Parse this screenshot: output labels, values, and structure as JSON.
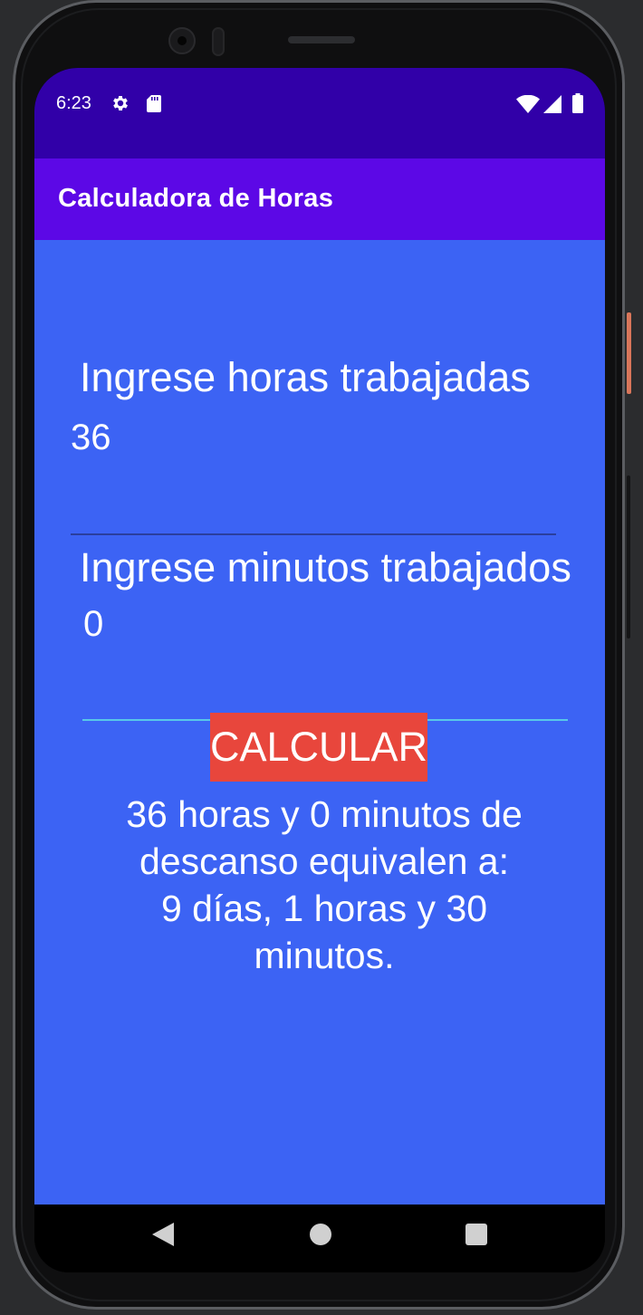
{
  "status_bar": {
    "time": "6:23",
    "icons": [
      "gear-icon",
      "sd-card-icon",
      "wifi-icon",
      "signal-icon",
      "battery-icon"
    ]
  },
  "app_bar": {
    "title": "Calculadora de Horas"
  },
  "form": {
    "hours_label": "Ingrese horas trabajadas",
    "hours_value": "36",
    "minutes_label": "Ingrese minutos trabajados",
    "minutes_value": "0",
    "calculate_label": "CALCULAR"
  },
  "result": {
    "lines": [
      "36 horas y 0 minutos de",
      "descanso equivalen a:",
      "9 días, 1 horas y 30",
      "minutos."
    ]
  },
  "colors": {
    "status_bar": "#3100a8",
    "app_bar": "#5c08e6",
    "content_bg": "#3c63f4",
    "button": "#e8463c",
    "focused_underline": "#58c8e8"
  },
  "nav_bar": {
    "icons": [
      "back-icon",
      "home-icon",
      "recents-icon"
    ]
  }
}
